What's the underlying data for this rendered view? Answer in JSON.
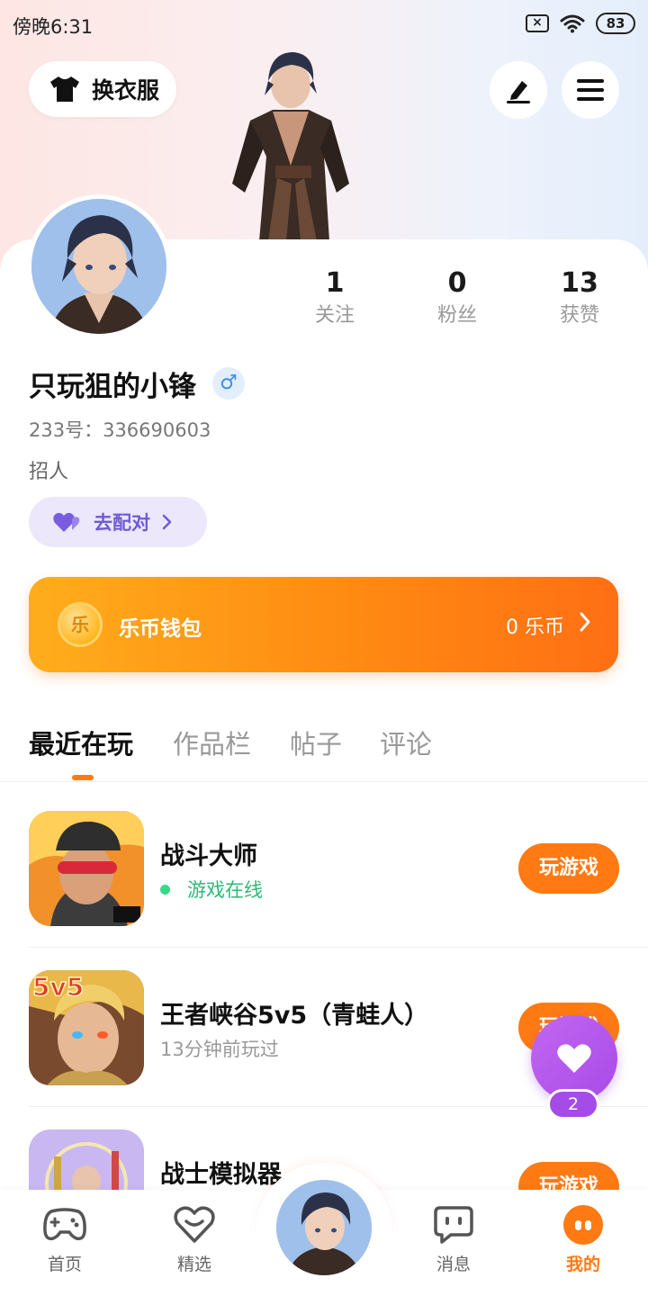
{
  "status_bar": {
    "time": "傍晚6:31",
    "battery": "83"
  },
  "header": {
    "dress_label": "换衣服"
  },
  "profile": {
    "stats": [
      {
        "value": "1",
        "label": "关注"
      },
      {
        "value": "0",
        "label": "粉丝"
      },
      {
        "value": "13",
        "label": "获赞"
      }
    ],
    "username": "只玩狙的小锋",
    "gender_symbol": "♂",
    "uid": "233号：336690603",
    "bio": "招人",
    "match_label": "去配对"
  },
  "wallet": {
    "coin_glyph": "乐",
    "label": "乐币钱包",
    "balance": "0 乐币"
  },
  "tabs": [
    "最近在玩",
    "作品栏",
    "帖子",
    "评论"
  ],
  "games": [
    {
      "title": "战斗大师",
      "status": "游戏在线",
      "online": true,
      "action": "玩游戏"
    },
    {
      "title": "王者峡谷5v5（青蛙人）",
      "status": "13分钟前玩过",
      "online": false,
      "action": "玩游戏",
      "badge": "5v5"
    },
    {
      "title": "战士模拟器",
      "status": "",
      "online": false,
      "action": "玩游戏"
    }
  ],
  "floating": {
    "count": "2"
  },
  "nav": {
    "items": [
      {
        "label": "首页"
      },
      {
        "label": "精选"
      },
      {
        "label": "消息"
      },
      {
        "label": "我的"
      }
    ],
    "active_color": "#ff7a13"
  },
  "colors": {
    "accent": "#ff7a13",
    "online": "#2bba76",
    "match": "#6f5bd6"
  }
}
